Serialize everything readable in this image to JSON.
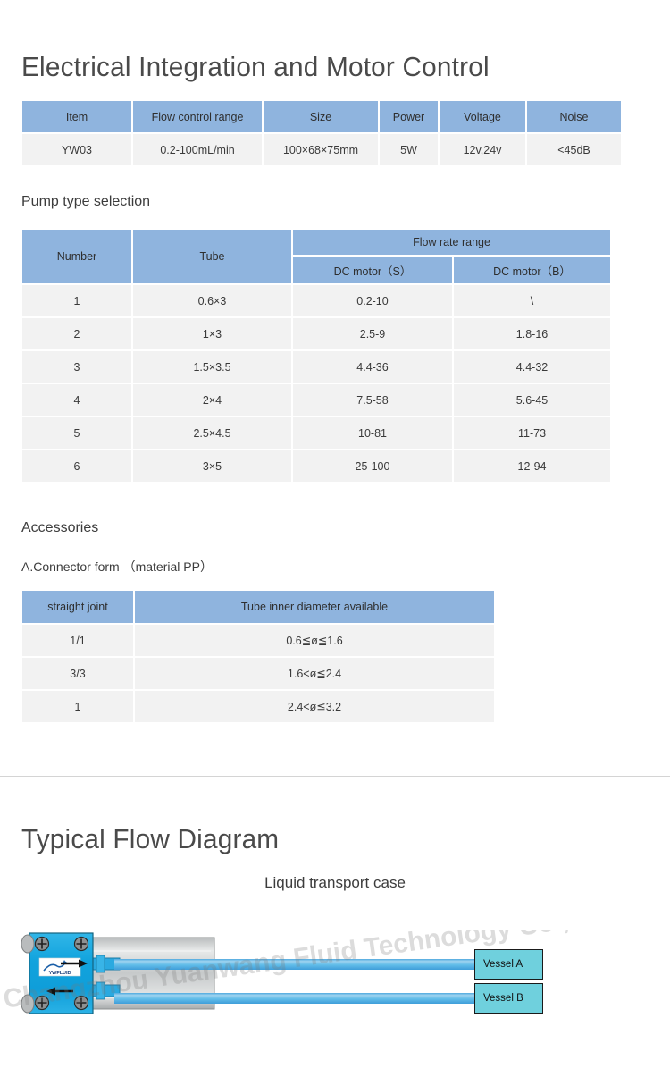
{
  "sections": {
    "electrical_title": "Electrical Integration and Motor Control",
    "pump_type_heading": "Pump type selection",
    "accessories_heading": "Accessories",
    "connector_heading": "A.Connector form （material PP）",
    "flow_title": "Typical Flow Diagram",
    "flow_caption": "Liquid transport case"
  },
  "specs_table": {
    "headers": [
      "Item",
      "Flow control range",
      "Size",
      "Power",
      "Voltage",
      "Noise"
    ],
    "rows": [
      [
        "YW03",
        "0.2-100mL/min",
        "100×68×75mm",
        "5W",
        "12v,24v",
        "<45dB"
      ]
    ]
  },
  "pump_table": {
    "header_number": "Number",
    "header_tube": "Tube",
    "header_flow_rate_range": "Flow rate range",
    "header_dc_motor_s": "DC motor（S）",
    "header_dc_motor_b": "DC motor（B）",
    "rows": [
      {
        "number": "1",
        "tube": "0.6×3",
        "dc_s": "0.2-10",
        "dc_b": "\\"
      },
      {
        "number": "2",
        "tube": "1×3",
        "dc_s": "2.5-9",
        "dc_b": "1.8-16"
      },
      {
        "number": "3",
        "tube": "1.5×3.5",
        "dc_s": "4.4-36",
        "dc_b": "4.4-32"
      },
      {
        "number": "4",
        "tube": "2×4",
        "dc_s": "7.5-58",
        "dc_b": "5.6-45"
      },
      {
        "number": "5",
        "tube": "2.5×4.5",
        "dc_s": "10-81",
        "dc_b": "11-73"
      },
      {
        "number": "6",
        "tube": "3×5",
        "dc_s": "25-100",
        "dc_b": "12-94"
      }
    ]
  },
  "connector_table": {
    "headers": [
      "straight joint",
      "Tube inner diameter available"
    ],
    "rows": [
      [
        "1/1",
        "0.6≦ø≦1.6"
      ],
      [
        "3/3",
        "1.6<ø≦2.4"
      ],
      [
        "1",
        "2.4<ø≦3.2"
      ]
    ]
  },
  "diagram": {
    "watermark": "Changzhou Yuanwang Fluid Technology Co., Ltd",
    "pump_logo": "YWFLUID",
    "vessel_a": "Vessel A",
    "vessel_b": "Vessel B"
  },
  "colors": {
    "header_blue": "#8fb4de",
    "row_gray": "#f2f2f2",
    "pump_blue": "#17a8e0",
    "vessel_cyan": "#6fd0dd",
    "tube_blue": "#5ab4e4",
    "divider": "#d4d4d4"
  }
}
